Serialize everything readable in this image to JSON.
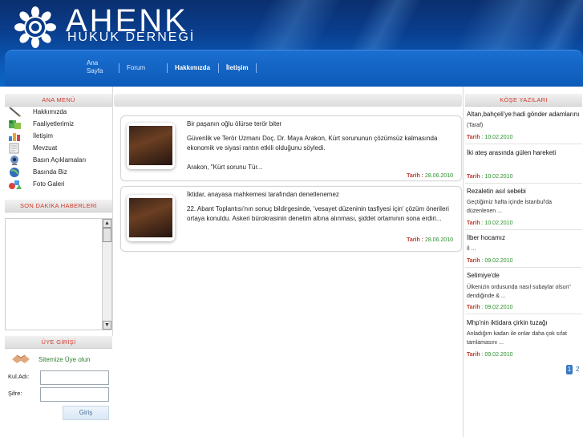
{
  "brand": {
    "title": "AHENK",
    "subtitle": "HUKUK DERNEĞİ"
  },
  "nav": {
    "home_line1": "Ana",
    "home_line2": "Sayfa",
    "forum": "Forum",
    "about": "Hakkımızda",
    "contact": "İletişim"
  },
  "left": {
    "menu_title": "ANA MENÜ",
    "menu": [
      {
        "label": "Hakkımızda",
        "icon": "pencil-icon"
      },
      {
        "label": "Faaliyetlerimiz",
        "icon": "tools-icon"
      },
      {
        "label": "İletişim",
        "icon": "chart-icon"
      },
      {
        "label": "Mevzuat",
        "icon": "document-icon"
      },
      {
        "label": "Basın Açıklamaları",
        "icon": "webcam-icon"
      },
      {
        "label": "Basında Biz",
        "icon": "globe-icon"
      },
      {
        "label": "Foto Galeri",
        "icon": "shapes-icon"
      }
    ],
    "news_title": "SON DAKİKA HABERLERİ",
    "scroll_up": "▲",
    "scroll_down": "▼",
    "login_title": "ÜYE GİRİŞİ",
    "register": "Sitemize Üye olun",
    "username_label": "Kul.Adı:",
    "password_label": "Şifre:",
    "login_button": "Giriş"
  },
  "articles": [
    {
      "title": "Bir paşanın oğlu ölürse terör biter",
      "body1": "Güvenlik ve Terör Uzmanı Doç. Dr. Maya Arakon, Kürt sorununun çözümsüz kalmasında ekonomik ve siyasi rantın etkili olduğunu söyledi.",
      "body2": "Arakon, \"Kürt sorunu Tür...",
      "date_label": "Tarih :",
      "date": "28.06.2010"
    },
    {
      "title": "İktidar, anayasa mahkemesi tarafından denetlenemez",
      "body1": "22. Abant Toplantısı'nın sonuç bildirgesinde, 'vesayet düzeninin tasfiyesi için' çözüm önerileri ortaya konuldu. Askeri bürokrasinin denetim altına alınması, şiddet ortamının sona erdiri...",
      "body2": "",
      "date_label": "Tarih :",
      "date": "28.06.2010"
    }
  ],
  "right": {
    "title": "KÖŞE YAZILARI",
    "items": [
      {
        "title": "Altan,bahçeli'ye:hadi gönder adamlarını",
        "sub": "(Taraf)",
        "date_label": "Tarih",
        "date": "10.02.2010"
      },
      {
        "title": "İki ateş arasında gülen hareketi",
        "sub": "",
        "date_label": "Tarih",
        "date": "10.02.2010"
      },
      {
        "title": "Rezaletin asıl sebebi",
        "sub": "Geçtiğimiz hafta içinde İstanbul'da düzenlenen ...",
        "date_label": "Tarih",
        "date": "10.02.2010"
      },
      {
        "title": "İlber hocamız",
        "sub": "İl ...",
        "date_label": "Tarih",
        "date": "09.02.2010"
      },
      {
        "title": "Selimiye'de",
        "sub": "Ülkenizin ordusunda nasıl subaylar olsun\" dendiğinde & ...",
        "date_label": "Tarih",
        "date": "09.02.2010"
      },
      {
        "title": "Mhp'nin iktidara çirkin tuzağı",
        "sub": "Anladığım kadarı ile onlar daha çok sıfat tamlamasını ...",
        "date_label": "Tarih",
        "date": "09.02.2010"
      }
    ],
    "pages": [
      "1",
      "2"
    ]
  },
  "colors": {
    "header_dark": "#0b2f6e",
    "header_light": "#0b68c6",
    "section_title": "#d23a2a",
    "date_green": "#2a8f2a",
    "date_label_red": "#c0392b"
  }
}
